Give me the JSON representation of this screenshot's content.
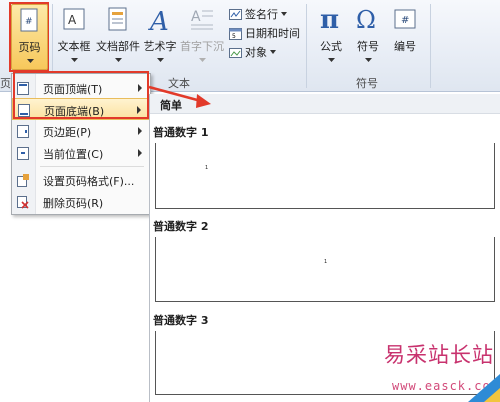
{
  "ribbon": {
    "page_number_label": "页码",
    "textbox_label": "文本框",
    "doc_parts_label": "文档部件",
    "wordart_label": "艺术字",
    "dropcap_label": "首字下沉",
    "signature_label": "签名行",
    "datetime_label": "日期和时间",
    "object_label": "对象",
    "formula_label": "公式",
    "symbol_label": "符号",
    "number_label": "编号",
    "group_left_label": "页眉",
    "group_text_label": "文本",
    "group_symbol_label": "符号"
  },
  "menu": {
    "items": [
      {
        "label": "页面顶端(T)",
        "icon": "page-top-icon"
      },
      {
        "label": "页面底端(B)",
        "icon": "page-bottom-icon"
      },
      {
        "label": "页边距(P)",
        "icon": "page-margin-icon"
      },
      {
        "label": "当前位置(C)",
        "icon": "current-position-icon"
      },
      {
        "label": "设置页码格式(F)...",
        "icon": "format-page-number-icon"
      },
      {
        "label": "删除页码(R)",
        "icon": "delete-page-number-icon"
      }
    ]
  },
  "gallery": {
    "header": "简单",
    "items": [
      {
        "title": "普通数字 1",
        "sample": "1"
      },
      {
        "title": "普通数字 2",
        "sample": "1"
      },
      {
        "title": "普通数字 3",
        "sample": ""
      }
    ]
  },
  "watermark": {
    "name": "易采站长站",
    "url": "www.easck.com"
  },
  "colors": {
    "highlight_border": "#e23a2a",
    "ribbon_bg": "#e9eef6",
    "menu_hover": "#fbe2a0"
  }
}
